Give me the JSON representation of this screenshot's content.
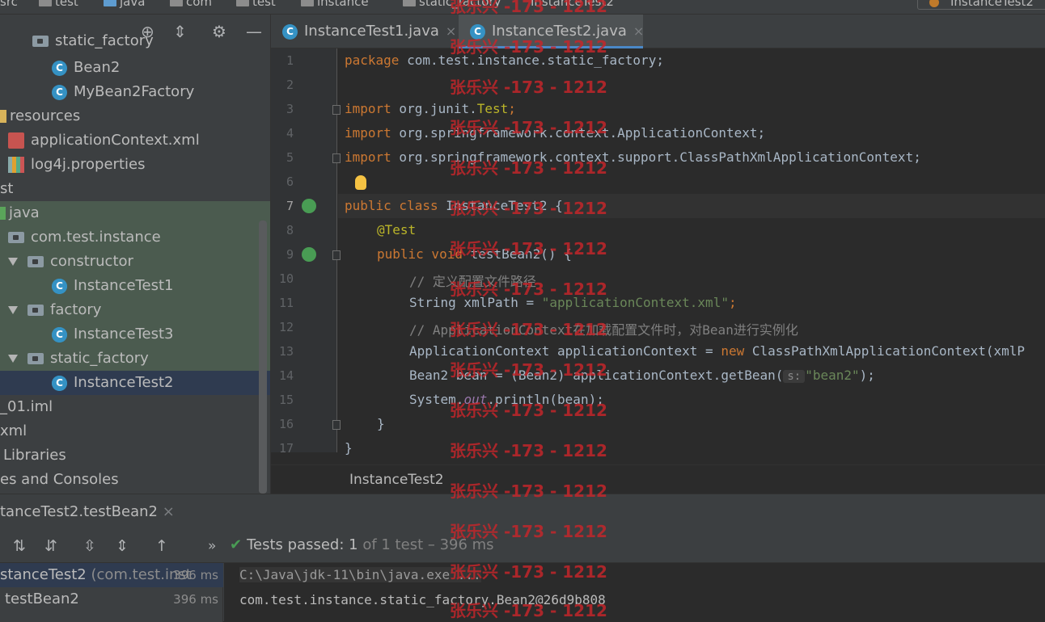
{
  "breadcrumb": {
    "items": [
      "src",
      "test",
      "java",
      "com",
      "test",
      "instance",
      "static_factory",
      "InstanceTest2"
    ],
    "right_config": "InstanceTest2"
  },
  "project": {
    "partial_top": "static_factory",
    "rows": [
      "Bean2",
      "MyBean2Factory",
      "resources",
      "applicationContext.xml",
      "log4j.properties",
      "st",
      "java",
      "com.test.instance",
      "constructor",
      "InstanceTest1",
      "factory",
      "InstanceTest3",
      "static_factory",
      "InstanceTest2",
      "_01.iml",
      "xml",
      "Libraries",
      "es and Consoles"
    ]
  },
  "editor": {
    "tabs": [
      {
        "label": "InstanceTest1.java",
        "close": "×"
      },
      {
        "label": "InstanceTest2.java",
        "close": "×"
      }
    ],
    "line_numbers": [
      "1",
      "2",
      "3",
      "4",
      "5",
      "6",
      "7",
      "8",
      "9",
      "10",
      "11",
      "12",
      "13",
      "14",
      "15",
      "16",
      "17"
    ],
    "code": {
      "l1": [
        "package",
        " com.test.instance.static_factory;"
      ],
      "l3": [
        "import",
        " org.junit.",
        "Test",
        ";"
      ],
      "l4": [
        "import",
        " org.springframework.context.ApplicationContext;"
      ],
      "l5": [
        "import",
        " org.springframework.context.support.ClassPathXmlApplicationContext;"
      ],
      "l7": [
        "public class",
        " InstanceTest2 {"
      ],
      "l8": "@Test",
      "l9": [
        "public void",
        " testBean2() {"
      ],
      "l10": "// 定义配置文件路径",
      "l11": [
        "String xmlPath = ",
        "\"applicationContext.xml\"",
        ";"
      ],
      "l12": "// ApplicationContext在加载配置文件时，对Bean进行实例化",
      "l13": [
        "ApplicationContext applicationContext = ",
        "new",
        " ClassPathXmlApplicationContext(xmlP"
      ],
      "l14": [
        "Bean2 bean = (Bean2) applicationContext.getBean(",
        "s:",
        "\"bean2\"",
        ");"
      ],
      "l15": [
        "System.",
        "out",
        ".println(bean);"
      ],
      "l16": "}",
      "l17": "}"
    },
    "crumb": "InstanceTest2"
  },
  "run": {
    "tab": "tanceTest2.testBean2",
    "tab_close": "×",
    "more": "»",
    "status_main": "Tests passed: ",
    "status_count": "1",
    "status_rest": " of 1 test – 396 ms",
    "tree": [
      {
        "label": "stanceTest2",
        "pkg": " (com.test.inst",
        "time": "396 ms"
      },
      {
        "label": "testBean2",
        "time": "396 ms"
      }
    ],
    "console": [
      "C:\\Java\\jdk-11\\bin\\java.exe ...",
      "com.test.instance.static_factory.Bean2@26d9b808"
    ]
  },
  "watermark": "张乐兴 -173 - 1212",
  "colors": {
    "keyword": "#cc7832",
    "string": "#6a8759",
    "comment": "#808080",
    "annotation": "#bbb529",
    "pass": "#499c54",
    "watermark": "#c8262a"
  }
}
